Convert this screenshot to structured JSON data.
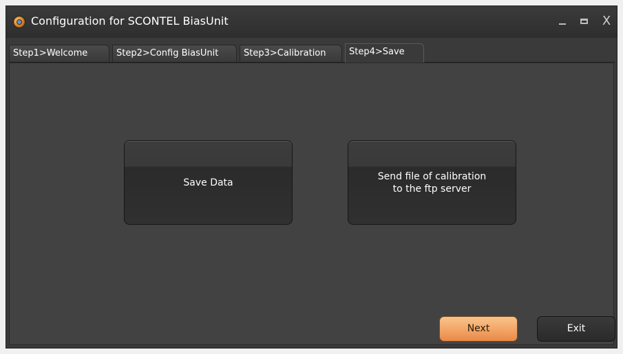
{
  "window": {
    "title": "Configuration for SCONTEL BiasUnit",
    "minimize_label": "_",
    "close_label": "X",
    "app_icon": "scontel-app-icon"
  },
  "tabs": [
    {
      "label": "Step1>Welcome",
      "active": false
    },
    {
      "label": "Step2>Config BiasUnit",
      "active": false
    },
    {
      "label": "Step3>Calibration",
      "active": false
    },
    {
      "label": "Step4>Save",
      "active": true
    }
  ],
  "main": {
    "save_data_label": "Save Data",
    "send_ftp_line1": "Send file of calibration",
    "send_ftp_line2": "to the ftp server"
  },
  "footer": {
    "next_label": "Next",
    "exit_label": "Exit"
  },
  "colors": {
    "background": "#424242",
    "titlebar": "#2e2e2e",
    "accent_next": "#f3a868",
    "text": "#ffffff"
  }
}
